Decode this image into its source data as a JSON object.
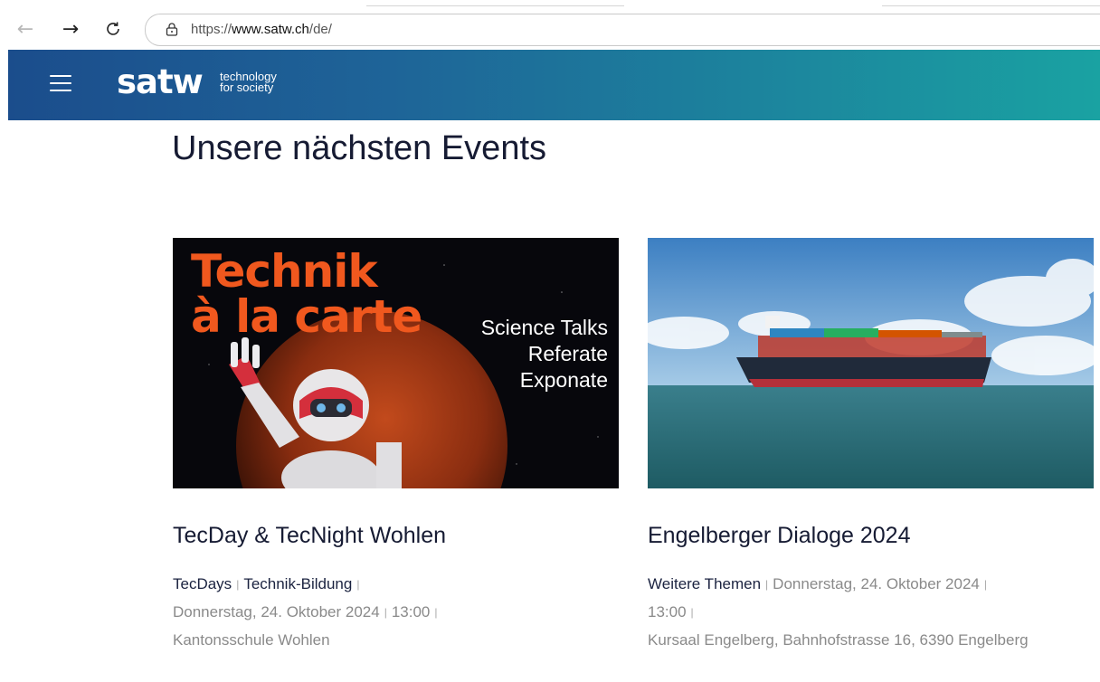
{
  "browser": {
    "url_scheme": "https://",
    "url_host": "www.satw.ch",
    "url_path": "/de/"
  },
  "header": {
    "logo_text": "satw",
    "tagline_line1": "technology",
    "tagline_line2": "for society",
    "colors": {
      "gradient_start": "#1b4d8c",
      "gradient_end": "#1aa2a2"
    }
  },
  "main": {
    "title": "Unsere nächsten Events",
    "events": [
      {
        "image_title_line1": "Technik",
        "image_title_line2": "à la carte",
        "image_subtitles": [
          "Science Talks",
          "Referate",
          "Exponate"
        ],
        "title": "TecDay & TecNight Wohlen",
        "tags": [
          "TecDays",
          "Technik-Bildung"
        ],
        "date": "Donnerstag, 24. Oktober 2024",
        "time": "13:00",
        "location": "Kantonsschule Wohlen"
      },
      {
        "title": "Engelberger Dialoge 2024",
        "tags": [
          "Weitere Themen"
        ],
        "date": "Donnerstag, 24. Oktober 2024",
        "time": "13:00",
        "location": "Kursaal Engelberg, Bahnhofstrasse 16, 6390 Engelberg"
      }
    ]
  }
}
